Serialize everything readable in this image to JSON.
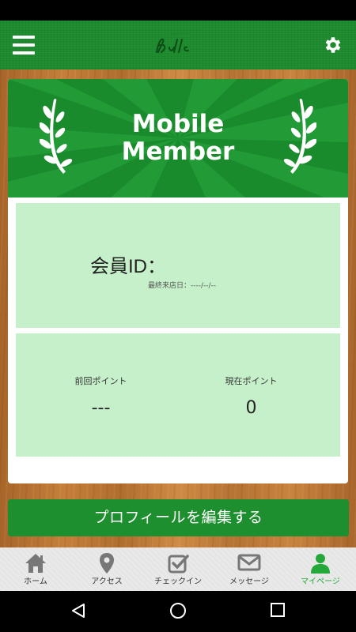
{
  "app_bar": {
    "menu_icon": "hamburger-menu-icon",
    "settings_icon": "gear-icon",
    "logo_text": "Bulls"
  },
  "banner": {
    "title_line1": "Mobile",
    "title_line2": "Member"
  },
  "member": {
    "id_label": "会員ID：",
    "last_visit_label": "最終来店日：----/--/--"
  },
  "points": {
    "previous_label": "前回ポイント",
    "previous_value": "---",
    "current_label": "現在ポイント",
    "current_value": "0"
  },
  "edit_profile_label": "プロフィールを編集する",
  "tabs": [
    {
      "label": "ホーム",
      "icon": "home-icon"
    },
    {
      "label": "アクセス",
      "icon": "map-pin-icon"
    },
    {
      "label": "チェックイン",
      "icon": "checkbox-icon"
    },
    {
      "label": "メッセージ",
      "icon": "mail-icon"
    },
    {
      "label": "マイページ",
      "icon": "user-icon",
      "active": true
    }
  ],
  "colors": {
    "primary_green": "#1c8a2d",
    "panel_green": "#c5f0c9",
    "active_tab": "#24a83a"
  }
}
